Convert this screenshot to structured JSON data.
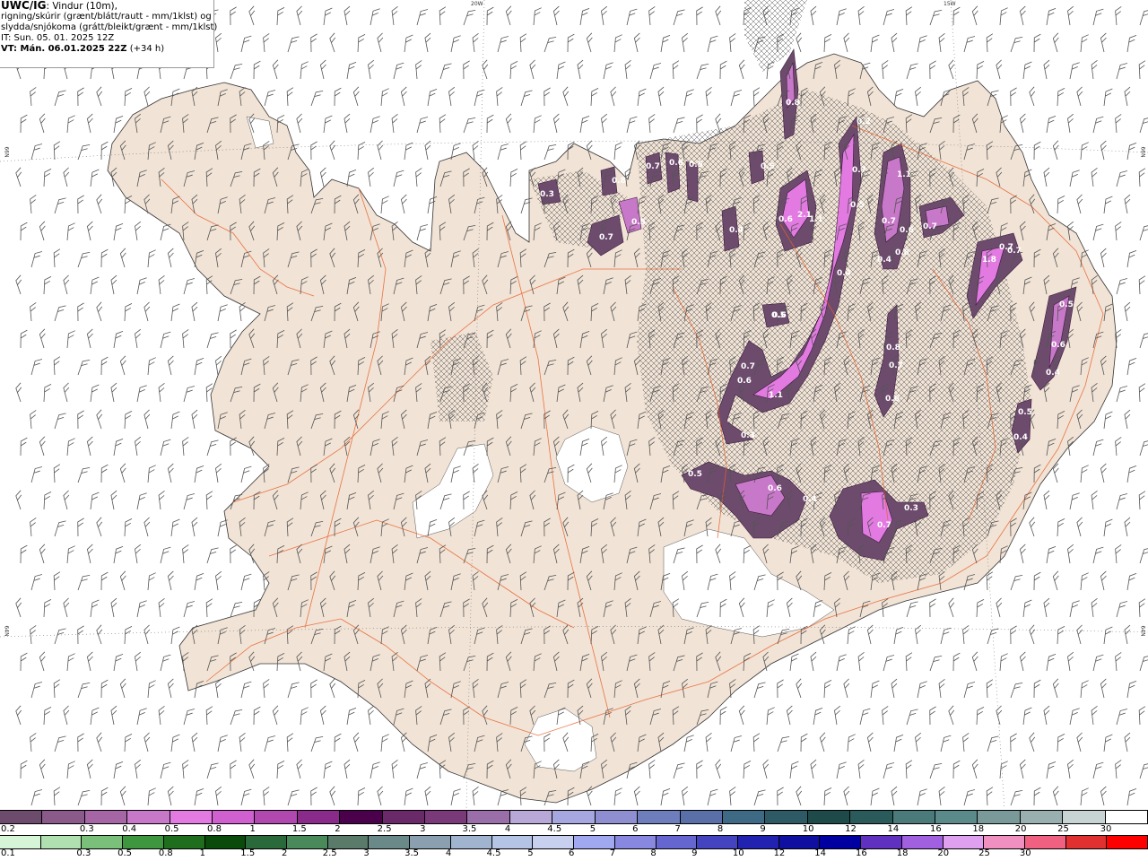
{
  "header": {
    "title_bold": "UWC/IG",
    "title_rest": ": Vindur (10m),",
    "line2": "rigning/skúrir (grænt/blátt/rautt - mm/1klst) og",
    "line3": "slydda/snjókoma (grátt/bleikt/grænt - mm/1klst)",
    "issue_time": "IT: Sun. 05. 01. 2025 12Z",
    "valid_label": "VT: Mán. 06.01.2025 22Z",
    "valid_offset": "(+34 h)"
  },
  "grid_labels": [
    "20W",
    "15W",
    "66N",
    "66N",
    "64N",
    "64N"
  ],
  "precip_labels": [
    "0.8",
    "0.7",
    "0.6",
    "0.5",
    "0.4",
    "0.3",
    "0.5",
    "0.7",
    "0.8",
    "1.1",
    "0.5",
    "0.7",
    "0.2",
    "0.5",
    "0.6",
    "2.1",
    "1.1",
    "0.7",
    "0.7",
    "0.6",
    "0.4",
    "0.8",
    "0.7",
    "1.8",
    "0.7",
    "0.5",
    "0.6",
    "0.4",
    "0.8",
    "0.7",
    "0.6",
    "0.5",
    "0.4",
    "0.4",
    "1.1",
    "0.3",
    "0.5",
    "0.6",
    "0.4",
    "0.7",
    "0.3",
    "0.6",
    "0.5",
    "0.7",
    "0.6"
  ],
  "legend_snow": {
    "colors": [
      "#6d4b6d",
      "#8a5a8a",
      "#a666a6",
      "#c878c8",
      "#e27ae2",
      "#d060d0",
      "#b048b0",
      "#8a2a8a",
      "#4a004a",
      "#6a2a6a",
      "#7a3a7a",
      "#9a6ea8",
      "#b8a8d8",
      "#a6a6e0",
      "#8e8ed0",
      "#6e7ebc",
      "#5a6ea8",
      "#3e6a86",
      "#2e5a66",
      "#1e4a4a",
      "#2a5a5a",
      "#4a7a7a",
      "#5a8a8a",
      "#7a9a9a",
      "#9ab0b0",
      "#c8d4d4",
      "#ffffff"
    ],
    "labels": [
      "0.2",
      "0.3",
      "0.4",
      "0.5",
      "0.8",
      "1",
      "1.5",
      "2",
      "2.5",
      "3",
      "3.5",
      "4",
      "4.5",
      "5",
      "6",
      "7",
      "8",
      "9",
      "10",
      "12",
      "14",
      "16",
      "18",
      "20",
      "25",
      "30"
    ]
  },
  "legend_rain": {
    "colors": [
      "#d6f5d6",
      "#b0e0b0",
      "#7ac07a",
      "#3e963e",
      "#1e6e1e",
      "#0a4a0a",
      "#2a6a3a",
      "#4a8a5a",
      "#5a7a6a",
      "#6a8a8a",
      "#8aa0b0",
      "#a0b4d0",
      "#b4c4e4",
      "#c8d0f0",
      "#a0a8f0",
      "#8888e0",
      "#6666d0",
      "#4444c0",
      "#2222b0",
      "#1010a0",
      "#0000a0",
      "#6030c0",
      "#a060e0",
      "#e0a0f0",
      "#f090c0",
      "#f06080",
      "#e03030",
      "#ff0000"
    ],
    "labels": [
      "0.1",
      "0.3",
      "0.5",
      "0.8",
      "1",
      "1.5",
      "2",
      "2.5",
      "3",
      "3.5",
      "4",
      "4.5",
      "5",
      "6",
      "7",
      "8",
      "9",
      "10",
      "12",
      "14",
      "16",
      "18",
      "20",
      "25",
      "30"
    ]
  }
}
